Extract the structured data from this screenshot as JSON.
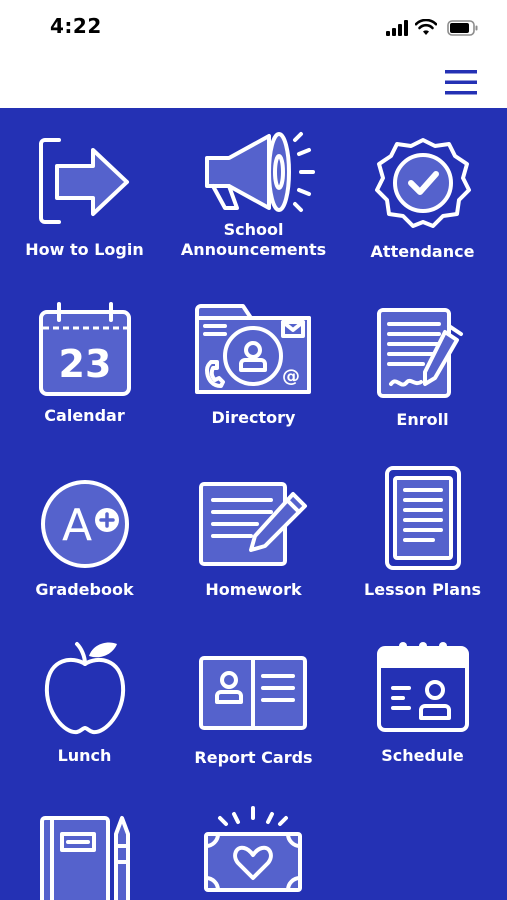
{
  "status_bar": {
    "time": "4:22"
  },
  "tiles": [
    {
      "label": "How to Login",
      "icon": "login-arrow-icon"
    },
    {
      "label": "School\nAnnouncements",
      "icon": "megaphone-icon"
    },
    {
      "label": "Attendance",
      "icon": "checkmark-badge-icon"
    },
    {
      "label": "Calendar",
      "icon": "calendar-icon",
      "date": "23"
    },
    {
      "label": "Directory",
      "icon": "contact-folder-icon",
      "at_symbol": "@"
    },
    {
      "label": "Enroll",
      "icon": "signed-document-icon"
    },
    {
      "label": "Gradebook",
      "icon": "grade-a-plus-icon",
      "grade": "A"
    },
    {
      "label": "Homework",
      "icon": "pencil-paper-icon"
    },
    {
      "label": "Lesson Plans",
      "icon": "tablet-icon"
    },
    {
      "label": "Lunch",
      "icon": "apple-icon"
    },
    {
      "label": "Report Cards",
      "icon": "open-book-icon"
    },
    {
      "label": "Schedule",
      "icon": "calendar-person-icon"
    },
    {
      "label": "",
      "icon": "notebook-crayon-icon"
    },
    {
      "label": "",
      "icon": "heart-money-icon"
    }
  ],
  "colors": {
    "background": "#2431b4",
    "icon_fill": "#5562cc",
    "header": "#ffffff",
    "menu": "#2431b4"
  }
}
